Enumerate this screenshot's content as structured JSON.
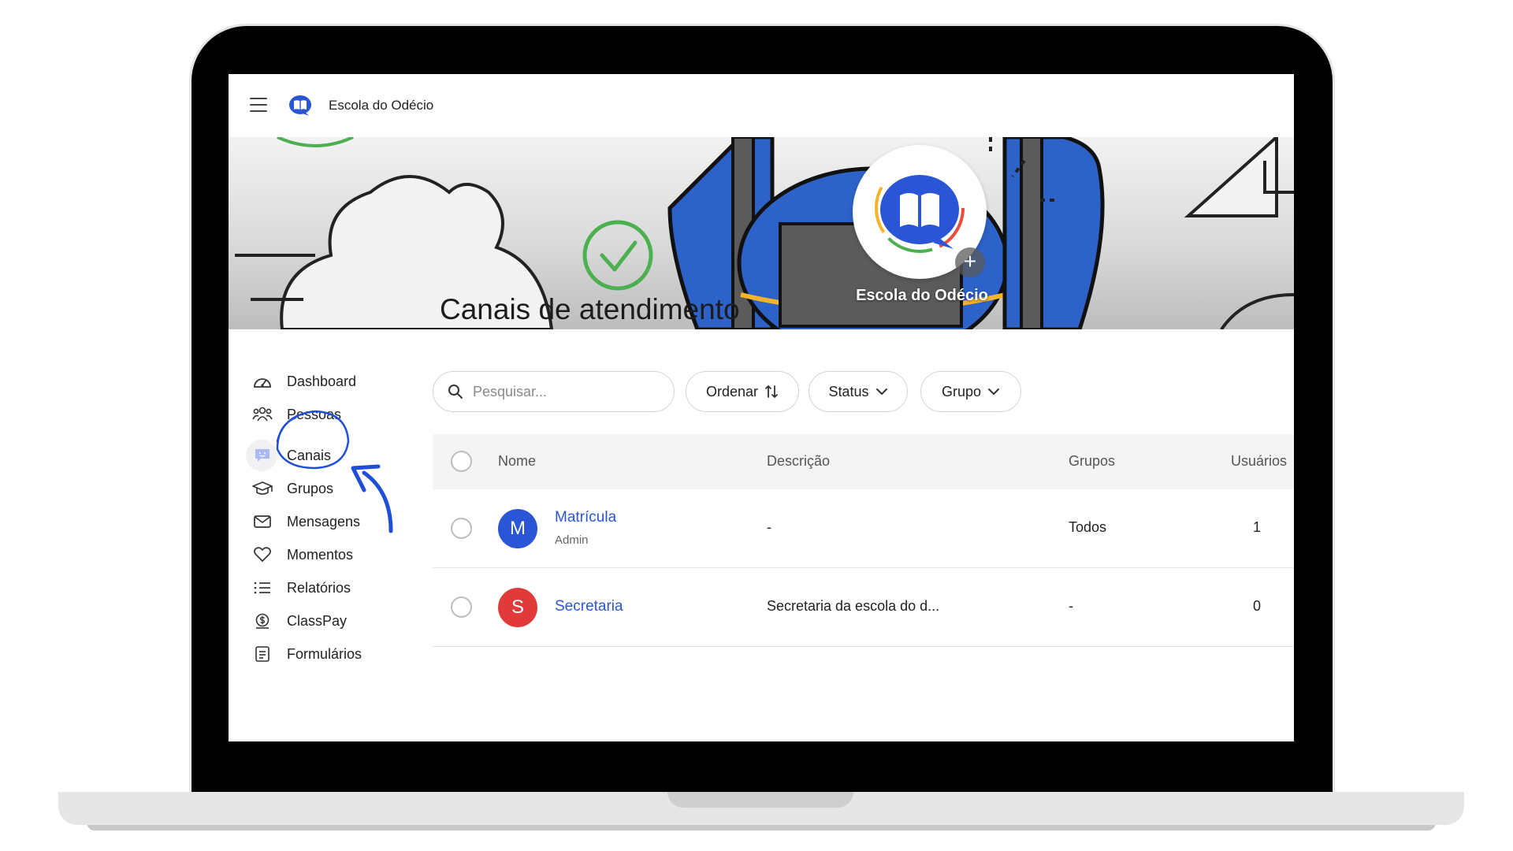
{
  "app": {
    "school_name": "Escola do Odécio"
  },
  "banner": {
    "school_name": "Escola do Odécio",
    "plus_symbol": "+"
  },
  "sidebar": {
    "items": [
      {
        "label": "Dashboard",
        "icon": "dashboard-icon",
        "active": false
      },
      {
        "label": "Pessoas",
        "icon": "people-icon",
        "active": false
      },
      {
        "label": "Canais",
        "icon": "channel-chat-icon",
        "active": true
      },
      {
        "label": "Grupos",
        "icon": "graduation-cap-icon",
        "active": false
      },
      {
        "label": "Mensagens",
        "icon": "envelope-icon",
        "active": false
      },
      {
        "label": "Momentos",
        "icon": "heart-icon",
        "active": false
      },
      {
        "label": "Relatórios",
        "icon": "list-icon",
        "active": false
      },
      {
        "label": "ClassPay",
        "icon": "money-bag-icon",
        "active": false
      },
      {
        "label": "Formulários",
        "icon": "form-icon",
        "active": false
      }
    ]
  },
  "main": {
    "title": "Canais de atendimento",
    "search_placeholder": "Pesquisar...",
    "filters": {
      "sort": "Ordenar",
      "status": "Status",
      "group": "Grupo"
    }
  },
  "table": {
    "headers": {
      "name": "Nome",
      "description": "Descrição",
      "groups": "Grupos",
      "users": "Usuários"
    },
    "rows": [
      {
        "initial": "M",
        "name": "Matrícula",
        "sub": "Admin",
        "description": "-",
        "groups": "Todos",
        "users": "1",
        "color": "#2a56d6"
      },
      {
        "initial": "S",
        "name": "Secretaria",
        "sub": "",
        "description": "Secretaria da escola do d...",
        "groups": "-",
        "users": "0",
        "color": "#e03a3a"
      }
    ]
  },
  "colors": {
    "brand_blue": "#2a56d6",
    "annotation_blue": "#1f4fd8"
  }
}
